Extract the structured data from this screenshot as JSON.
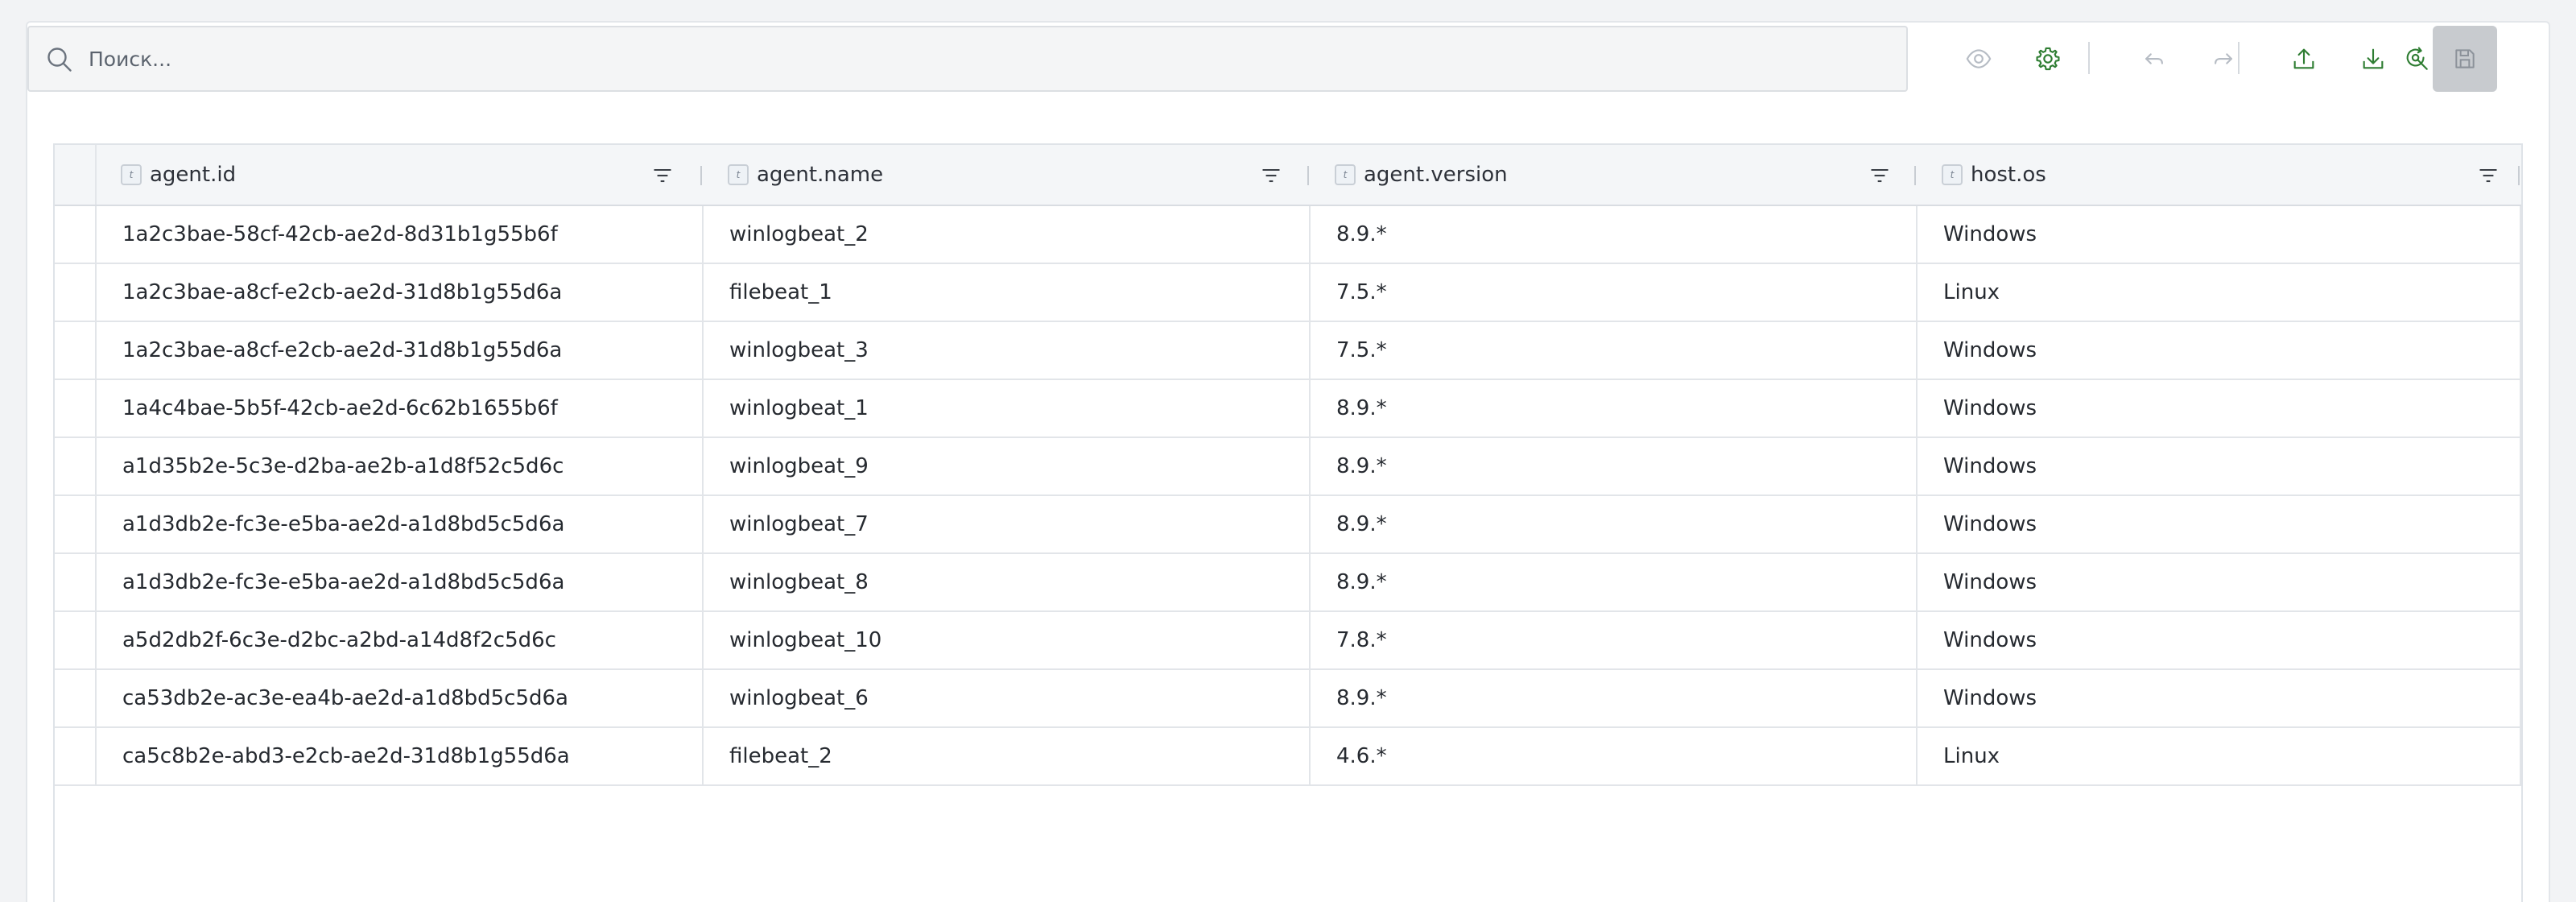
{
  "search": {
    "placeholder": "Поиск..."
  },
  "toolbar": {
    "icons": [
      "eye-icon",
      "gear-icon",
      "undo-icon",
      "redo-icon",
      "upload-icon",
      "download-icon",
      "refresh-search-icon",
      "save-icon"
    ],
    "accent": "#2e7d32",
    "disabled": "#b6bcc4"
  },
  "table": {
    "type_badge": "t",
    "columns": [
      "agent.id",
      "agent.name",
      "agent.version",
      "host.os"
    ],
    "rows": [
      [
        "1a2c3bae-58cf-42cb-ae2d-8d31b1g55b6f",
        "winlogbeat_2",
        "8.9.*",
        "Windows"
      ],
      [
        "1a2c3bae-a8cf-e2cb-ae2d-31d8b1g55d6a",
        "filebeat_1",
        "7.5.*",
        "Linux"
      ],
      [
        "1a2c3bae-a8cf-e2cb-ae2d-31d8b1g55d6a",
        "winlogbeat_3",
        "7.5.*",
        "Windows"
      ],
      [
        "1a4c4bae-5b5f-42cb-ae2d-6c62b1655b6f",
        "winlogbeat_1",
        "8.9.*",
        "Windows"
      ],
      [
        "a1d35b2e-5c3e-d2ba-ae2b-a1d8f52c5d6c",
        "winlogbeat_9",
        "8.9.*",
        "Windows"
      ],
      [
        "a1d3db2e-fc3e-e5ba-ae2d-a1d8bd5c5d6a",
        "winlogbeat_7",
        "8.9.*",
        "Windows"
      ],
      [
        "a1d3db2e-fc3e-e5ba-ae2d-a1d8bd5c5d6a",
        "winlogbeat_8",
        "8.9.*",
        "Windows"
      ],
      [
        "a5d2db2f-6c3e-d2bc-a2bd-a14d8f2c5d6c",
        "winlogbeat_10",
        "7.8.*",
        "Windows"
      ],
      [
        "ca53db2e-ac3e-ea4b-ae2d-a1d8bd5c5d6a",
        "winlogbeat_6",
        "8.9.*",
        "Windows"
      ],
      [
        "ca5c8b2e-abd3-e2cb-ae2d-31d8b1g55d6a",
        "filebeat_2",
        "4.6.*",
        "Linux"
      ]
    ]
  }
}
